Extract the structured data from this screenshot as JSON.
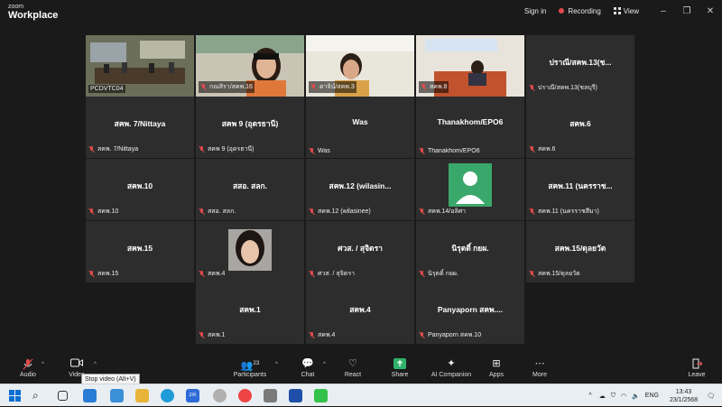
{
  "app": {
    "logo_line1": "zoom",
    "logo_line2": "Workplace"
  },
  "topbar": {
    "signin": "Sign in",
    "recording": "Recording",
    "view": "View"
  },
  "tiles": [
    {
      "name": "PCDVTC04",
      "display": "",
      "video": "room",
      "active": true
    },
    {
      "name": "กณสิรา/สคพ.16",
      "display": "",
      "video": "woman1"
    },
    {
      "name": "ดาจิน์/สคพ.3",
      "display": "",
      "video": "woman2"
    },
    {
      "name": "สคพ.8",
      "display": "",
      "video": "office"
    },
    {
      "name": "ปราณี/สคพ.13(ชลบุรี)",
      "display": "ปราณี/สคพ.13(ช..."
    },
    {
      "name": "สคพ. 7/Nittaya",
      "display": "สคพ. 7/Nittaya"
    },
    {
      "name": "สคพ 9 (อุดรธานี)",
      "display": "สคพ 9 (อุดรธานี)"
    },
    {
      "name": "Was",
      "display": "Was"
    },
    {
      "name": "Thanakhom/EPO6",
      "display": "Thanakhom/EPO6"
    },
    {
      "name": "สคพ.6",
      "display": "สคพ.6"
    },
    {
      "name": "สคพ.10",
      "display": "สคพ.10"
    },
    {
      "name": "สสอ. สลก.",
      "display": "สสอ. สลก."
    },
    {
      "name": "สคพ.12 (wilasinee)",
      "display": "สคพ.12 (wilasin..."
    },
    {
      "name": "สคพ.14/อลิศา",
      "display": "",
      "video": "avatar"
    },
    {
      "name": "สคพ.11 (นครราชสีมา)",
      "display": "สคพ.11 (นครราช..."
    },
    {
      "name": "สคพ.15",
      "display": "สคพ.15"
    },
    {
      "name": "สคพ.4",
      "display": "",
      "video": "selfie"
    },
    {
      "name": "ศวส. / สุจิตรา",
      "display": "ศวส. / สุจิตรา"
    },
    {
      "name": "นิรุตติ์ กยผ.",
      "display": "นิรุตติ์ กยผ."
    },
    {
      "name": "สคพ.15/ดุลยวัต",
      "display": "สคพ.15/ดุลยวัต"
    },
    {
      "name": "สคพ.1",
      "display": "สคพ.1"
    },
    {
      "name": "สคพ.4",
      "display": "สคพ.4"
    },
    {
      "name": "Panyaporn สคพ.10",
      "display": "Panyaporn สคพ...."
    }
  ],
  "toolbar": {
    "audio": "Audio",
    "video": "Video",
    "participants": "Participants",
    "participants_count": "23",
    "chat": "Chat",
    "react": "React",
    "share": "Share",
    "ai": "AI Companion",
    "apps": "Apps",
    "more": "More",
    "leave": "Leave",
    "tooltip": "Stop video (Alt+V)"
  },
  "tray": {
    "lang": "ENG",
    "time": "13:43",
    "date": "23/1/2568"
  },
  "colors": {
    "accent_green": "#4caf7a",
    "mute_red": "#e04a4a",
    "share_green": "#2fb36a"
  }
}
